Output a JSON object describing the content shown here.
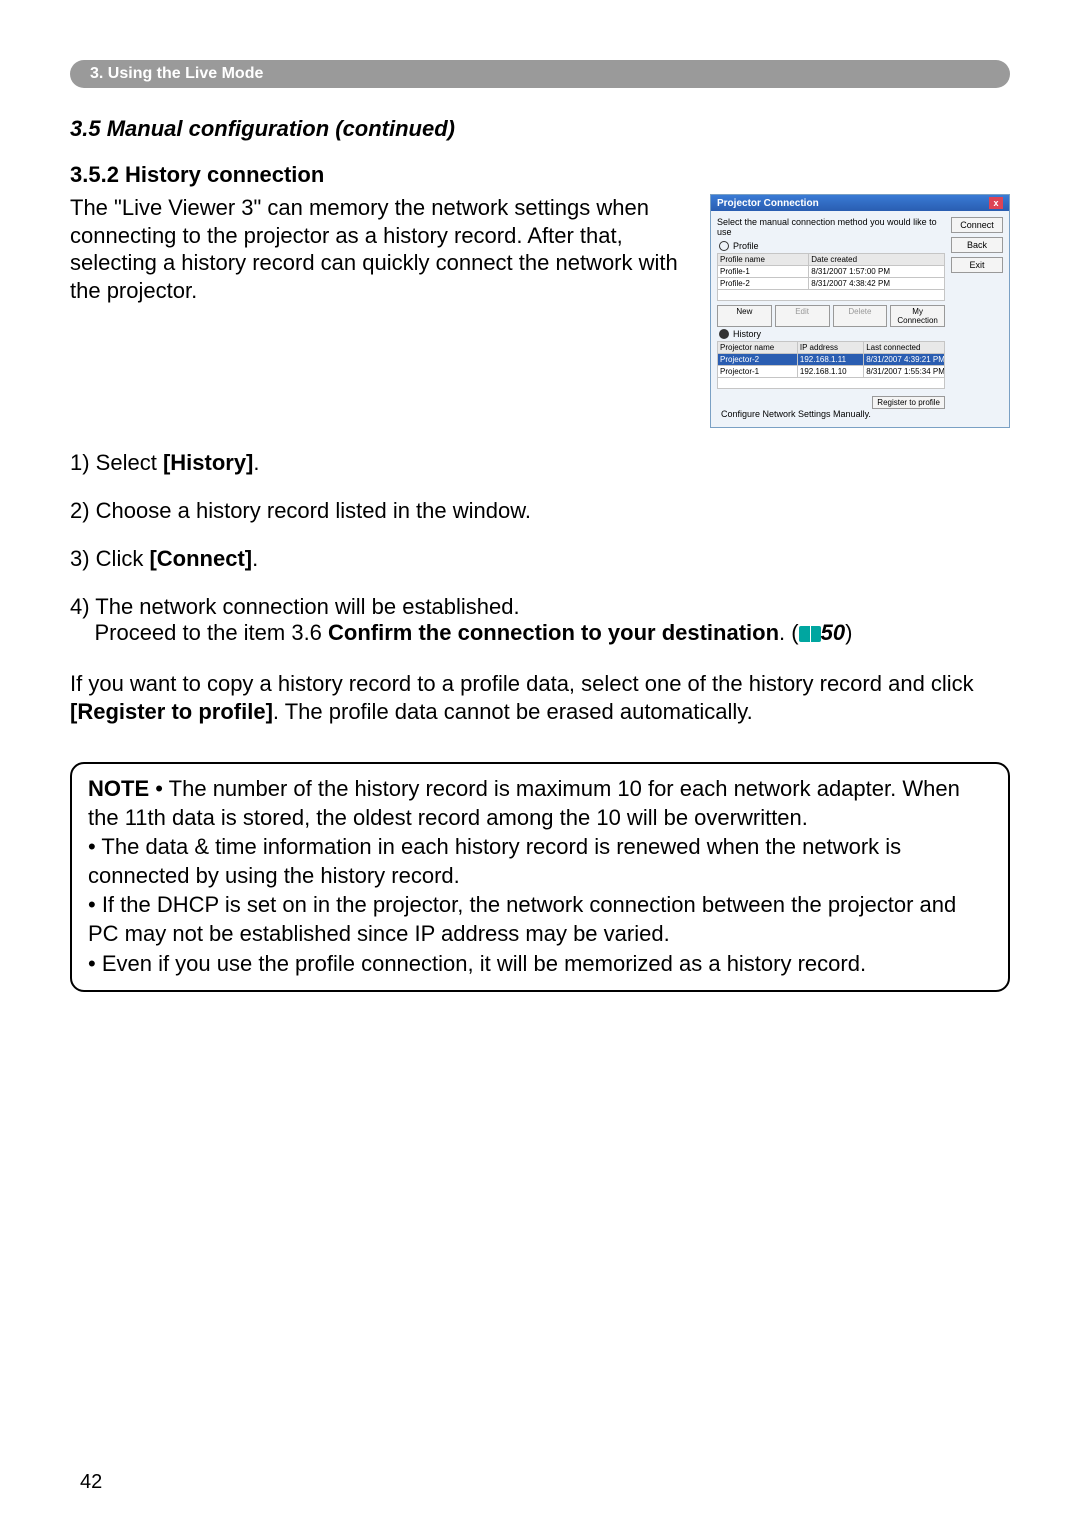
{
  "header": {
    "breadcrumb": "3. Using the Live Mode"
  },
  "section_title": "3.5 Manual configuration (continued)",
  "subheading": "3.5.2 History connection",
  "intro": "The \"Live Viewer 3\" can memory the network settings when connecting to the projector as a history record. After that, selecting a history record can quickly connect the network with the projector.",
  "steps": {
    "s1_a": "1) Select ",
    "s1_b": "[History]",
    "s1_c": ".",
    "s2": "2) Choose a history record listed in the window.",
    "s3_a": "3) Click ",
    "s3_b": "[Connect]",
    "s3_c": ".",
    "s4_a": "4) The network connection will be established.",
    "s4_b": "Proceed to the item 3.6 ",
    "s4_c": "Confirm the connection to your destination",
    "s4_d": ". (",
    "s4_e": "50",
    "s4_f": ")"
  },
  "copy_para_a": "If you want to copy a history record to a profile data, select one of the history record and click ",
  "copy_para_b": "[Register to profile]",
  "copy_para_c": ". The profile data cannot be erased automatically.",
  "note": {
    "label": "NOTE",
    "n1": "• The number of the history record is maximum 10 for each network adapter. When the 11th data is stored, the oldest record among the 10 will be overwritten.",
    "n2": "• The data & time information in each history record is renewed when the network is connected by using the history record.",
    "n3": "• If the DHCP is set on in the projector, the network connection between the projector and PC may not be established since IP address may be varied.",
    "n4": "• Even if you use the profile connection, it will be memorized as a history record."
  },
  "page_number": "42",
  "dialog": {
    "title": "Projector Connection",
    "instruction": "Select the manual connection method you would like to use",
    "radio_profile": "Profile",
    "radio_history": "History",
    "radio_manual": "Configure Network Settings Manually.",
    "buttons": {
      "connect": "Connect",
      "back": "Back",
      "exit": "Exit"
    },
    "profile_table": {
      "cols": [
        "Profile name",
        "Date created"
      ],
      "rows": [
        {
          "name": "Profile-1",
          "date": "8/31/2007 1:57:00 PM"
        },
        {
          "name": "Profile-2",
          "date": "8/31/2007 4:38:42 PM"
        }
      ]
    },
    "btn_row": {
      "new": "New",
      "edit": "Edit",
      "delete": "Delete",
      "myconn": "My Connection"
    },
    "history_table": {
      "cols": [
        "Projector name",
        "IP address",
        "Last connected"
      ],
      "rows": [
        {
          "name": "Projector-2",
          "ip": "192.168.1.11",
          "last": "8/31/2007 4:39:21 PM"
        },
        {
          "name": "Projector-1",
          "ip": "192.168.1.10",
          "last": "8/31/2007 1:55:34 PM"
        }
      ]
    },
    "register": "Register to profile"
  }
}
